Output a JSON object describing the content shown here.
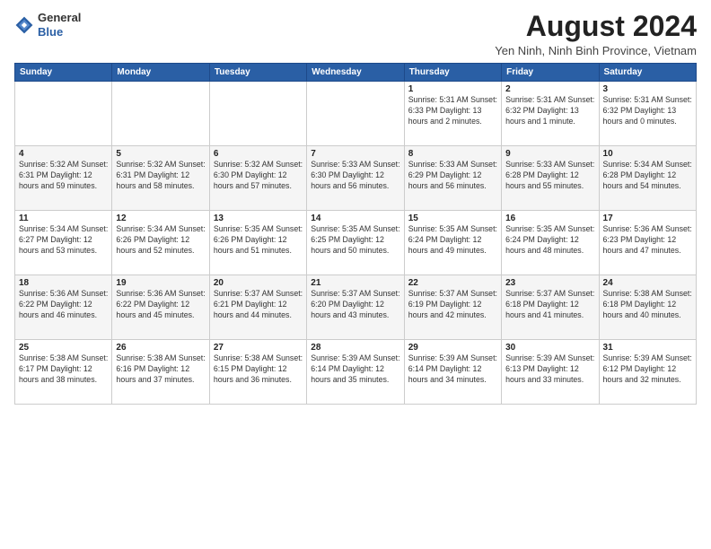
{
  "logo": {
    "general": "General",
    "blue": "Blue"
  },
  "title": "August 2024",
  "subtitle": "Yen Ninh, Ninh Binh Province, Vietnam",
  "days_header": [
    "Sunday",
    "Monday",
    "Tuesday",
    "Wednesday",
    "Thursday",
    "Friday",
    "Saturday"
  ],
  "weeks": [
    [
      {
        "day": "",
        "info": ""
      },
      {
        "day": "",
        "info": ""
      },
      {
        "day": "",
        "info": ""
      },
      {
        "day": "",
        "info": ""
      },
      {
        "day": "1",
        "info": "Sunrise: 5:31 AM\nSunset: 6:33 PM\nDaylight: 13 hours\nand 2 minutes."
      },
      {
        "day": "2",
        "info": "Sunrise: 5:31 AM\nSunset: 6:32 PM\nDaylight: 13 hours\nand 1 minute."
      },
      {
        "day": "3",
        "info": "Sunrise: 5:31 AM\nSunset: 6:32 PM\nDaylight: 13 hours\nand 0 minutes."
      }
    ],
    [
      {
        "day": "4",
        "info": "Sunrise: 5:32 AM\nSunset: 6:31 PM\nDaylight: 12 hours\nand 59 minutes."
      },
      {
        "day": "5",
        "info": "Sunrise: 5:32 AM\nSunset: 6:31 PM\nDaylight: 12 hours\nand 58 minutes."
      },
      {
        "day": "6",
        "info": "Sunrise: 5:32 AM\nSunset: 6:30 PM\nDaylight: 12 hours\nand 57 minutes."
      },
      {
        "day": "7",
        "info": "Sunrise: 5:33 AM\nSunset: 6:30 PM\nDaylight: 12 hours\nand 56 minutes."
      },
      {
        "day": "8",
        "info": "Sunrise: 5:33 AM\nSunset: 6:29 PM\nDaylight: 12 hours\nand 56 minutes."
      },
      {
        "day": "9",
        "info": "Sunrise: 5:33 AM\nSunset: 6:28 PM\nDaylight: 12 hours\nand 55 minutes."
      },
      {
        "day": "10",
        "info": "Sunrise: 5:34 AM\nSunset: 6:28 PM\nDaylight: 12 hours\nand 54 minutes."
      }
    ],
    [
      {
        "day": "11",
        "info": "Sunrise: 5:34 AM\nSunset: 6:27 PM\nDaylight: 12 hours\nand 53 minutes."
      },
      {
        "day": "12",
        "info": "Sunrise: 5:34 AM\nSunset: 6:26 PM\nDaylight: 12 hours\nand 52 minutes."
      },
      {
        "day": "13",
        "info": "Sunrise: 5:35 AM\nSunset: 6:26 PM\nDaylight: 12 hours\nand 51 minutes."
      },
      {
        "day": "14",
        "info": "Sunrise: 5:35 AM\nSunset: 6:25 PM\nDaylight: 12 hours\nand 50 minutes."
      },
      {
        "day": "15",
        "info": "Sunrise: 5:35 AM\nSunset: 6:24 PM\nDaylight: 12 hours\nand 49 minutes."
      },
      {
        "day": "16",
        "info": "Sunrise: 5:35 AM\nSunset: 6:24 PM\nDaylight: 12 hours\nand 48 minutes."
      },
      {
        "day": "17",
        "info": "Sunrise: 5:36 AM\nSunset: 6:23 PM\nDaylight: 12 hours\nand 47 minutes."
      }
    ],
    [
      {
        "day": "18",
        "info": "Sunrise: 5:36 AM\nSunset: 6:22 PM\nDaylight: 12 hours\nand 46 minutes."
      },
      {
        "day": "19",
        "info": "Sunrise: 5:36 AM\nSunset: 6:22 PM\nDaylight: 12 hours\nand 45 minutes."
      },
      {
        "day": "20",
        "info": "Sunrise: 5:37 AM\nSunset: 6:21 PM\nDaylight: 12 hours\nand 44 minutes."
      },
      {
        "day": "21",
        "info": "Sunrise: 5:37 AM\nSunset: 6:20 PM\nDaylight: 12 hours\nand 43 minutes."
      },
      {
        "day": "22",
        "info": "Sunrise: 5:37 AM\nSunset: 6:19 PM\nDaylight: 12 hours\nand 42 minutes."
      },
      {
        "day": "23",
        "info": "Sunrise: 5:37 AM\nSunset: 6:18 PM\nDaylight: 12 hours\nand 41 minutes."
      },
      {
        "day": "24",
        "info": "Sunrise: 5:38 AM\nSunset: 6:18 PM\nDaylight: 12 hours\nand 40 minutes."
      }
    ],
    [
      {
        "day": "25",
        "info": "Sunrise: 5:38 AM\nSunset: 6:17 PM\nDaylight: 12 hours\nand 38 minutes."
      },
      {
        "day": "26",
        "info": "Sunrise: 5:38 AM\nSunset: 6:16 PM\nDaylight: 12 hours\nand 37 minutes."
      },
      {
        "day": "27",
        "info": "Sunrise: 5:38 AM\nSunset: 6:15 PM\nDaylight: 12 hours\nand 36 minutes."
      },
      {
        "day": "28",
        "info": "Sunrise: 5:39 AM\nSunset: 6:14 PM\nDaylight: 12 hours\nand 35 minutes."
      },
      {
        "day": "29",
        "info": "Sunrise: 5:39 AM\nSunset: 6:14 PM\nDaylight: 12 hours\nand 34 minutes."
      },
      {
        "day": "30",
        "info": "Sunrise: 5:39 AM\nSunset: 6:13 PM\nDaylight: 12 hours\nand 33 minutes."
      },
      {
        "day": "31",
        "info": "Sunrise: 5:39 AM\nSunset: 6:12 PM\nDaylight: 12 hours\nand 32 minutes."
      }
    ]
  ]
}
